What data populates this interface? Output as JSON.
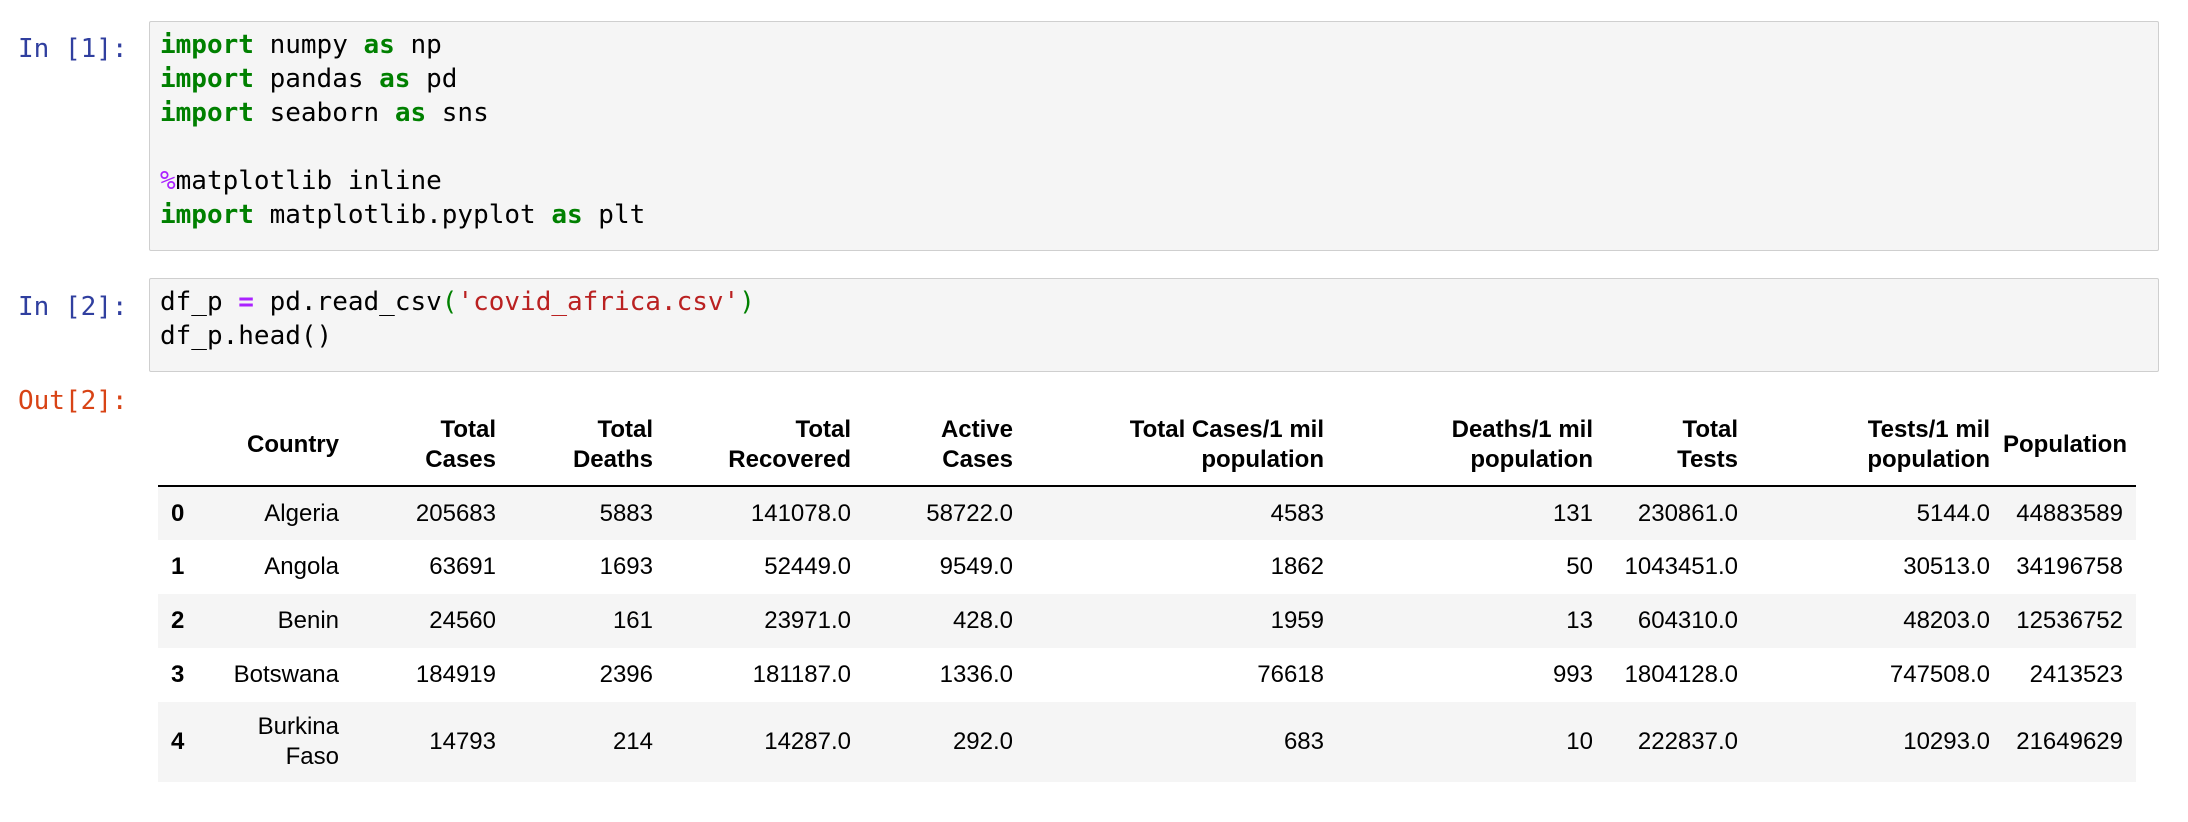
{
  "cells": [
    {
      "prompt": "In [1]:",
      "lines": [
        [
          {
            "t": "import",
            "c": "kw"
          },
          {
            "t": " numpy ",
            "c": ""
          },
          {
            "t": "as",
            "c": "kw"
          },
          {
            "t": " np",
            "c": ""
          }
        ],
        [
          {
            "t": "import",
            "c": "kw"
          },
          {
            "t": " pandas ",
            "c": ""
          },
          {
            "t": "as",
            "c": "kw"
          },
          {
            "t": " pd",
            "c": ""
          }
        ],
        [
          {
            "t": "import",
            "c": "kw"
          },
          {
            "t": " seaborn ",
            "c": ""
          },
          {
            "t": "as",
            "c": "kw"
          },
          {
            "t": " sns",
            "c": ""
          }
        ],
        [],
        [
          {
            "t": "%",
            "c": "magic"
          },
          {
            "t": "matplotlib inline",
            "c": ""
          }
        ],
        [
          {
            "t": "import",
            "c": "kw"
          },
          {
            "t": " matplotlib.pyplot ",
            "c": ""
          },
          {
            "t": "as",
            "c": "kw"
          },
          {
            "t": " plt",
            "c": ""
          }
        ]
      ]
    },
    {
      "prompt": "In [2]:",
      "lines": [
        [
          {
            "t": "df_p ",
            "c": ""
          },
          {
            "t": "=",
            "c": "op"
          },
          {
            "t": " pd.read_csv",
            "c": ""
          },
          {
            "t": "(",
            "c": "paren"
          },
          {
            "t": "'covid_africa.csv'",
            "c": "str"
          },
          {
            "t": ")",
            "c": "paren"
          }
        ],
        [
          {
            "t": "df_p.head()",
            "c": ""
          }
        ]
      ]
    }
  ],
  "output": {
    "prompt": "Out[2]:",
    "columns": [
      [
        "Country"
      ],
      [
        "Total",
        "Cases"
      ],
      [
        "Total",
        "Deaths"
      ],
      [
        "Total",
        "Recovered"
      ],
      [
        "Active",
        "Cases"
      ],
      [
        "Total Cases/1 mil",
        "population"
      ],
      [
        "Deaths/1 mil",
        "population"
      ],
      [
        "Total",
        "Tests"
      ],
      [
        "Tests/1 mil",
        "population"
      ],
      [
        "Population"
      ]
    ],
    "rows": [
      {
        "index": "0",
        "values": [
          [
            "Algeria"
          ],
          "205683",
          "5883",
          "141078.0",
          "58722.0",
          "4583",
          "131",
          "230861.0",
          "5144.0",
          "44883589"
        ]
      },
      {
        "index": "1",
        "values": [
          [
            "Angola"
          ],
          "63691",
          "1693",
          "52449.0",
          "9549.0",
          "1862",
          "50",
          "1043451.0",
          "30513.0",
          "34196758"
        ]
      },
      {
        "index": "2",
        "values": [
          [
            "Benin"
          ],
          "24560",
          "161",
          "23971.0",
          "428.0",
          "1959",
          "13",
          "604310.0",
          "48203.0",
          "12536752"
        ]
      },
      {
        "index": "3",
        "values": [
          [
            "Botswana"
          ],
          "184919",
          "2396",
          "181187.0",
          "1336.0",
          "76618",
          "993",
          "1804128.0",
          "747508.0",
          "2413523"
        ]
      },
      {
        "index": "4",
        "values": [
          [
            "Burkina",
            "Faso"
          ],
          "14793",
          "214",
          "14287.0",
          "292.0",
          "683",
          "10",
          "222837.0",
          "10293.0",
          "21649629"
        ]
      }
    ]
  }
}
